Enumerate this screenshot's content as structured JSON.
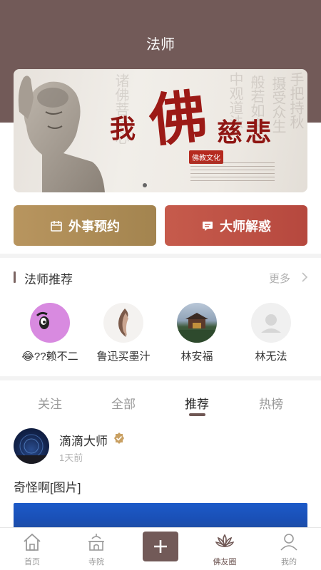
{
  "header": {
    "title": "法师",
    "bg_color": "#725a58"
  },
  "banner": {
    "big_char": "佛",
    "left_char": "我",
    "right_chars": "慈悲",
    "seal": "佛教文化",
    "active_dot": 1
  },
  "actions": {
    "external_label": "外事预约",
    "master_label": "大师解惑",
    "gold_color": "#b8955f",
    "red_color": "#c65b4c"
  },
  "recommend": {
    "title": "法师推荐",
    "more": "更多",
    "masters": [
      {
        "name": "😂??赖不二"
      },
      {
        "name": "鲁迅买墨汁"
      },
      {
        "name": "林安福"
      },
      {
        "name": "林无法"
      }
    ]
  },
  "tabs": [
    {
      "label": "关注",
      "active": false
    },
    {
      "label": "全部",
      "active": false
    },
    {
      "label": "推荐",
      "active": true
    },
    {
      "label": "热榜",
      "active": false
    }
  ],
  "post": {
    "author": "滴滴大师",
    "time": "1天前",
    "content": "奇怪啊[图片]"
  },
  "tabbar": {
    "items": [
      {
        "label": "首页",
        "icon": "home-icon"
      },
      {
        "label": "寺院",
        "icon": "temple-icon"
      },
      {
        "label": "佛友圈",
        "icon": "lotus-icon"
      },
      {
        "label": "我的",
        "icon": "profile-icon"
      }
    ],
    "active": "佛友圈"
  }
}
